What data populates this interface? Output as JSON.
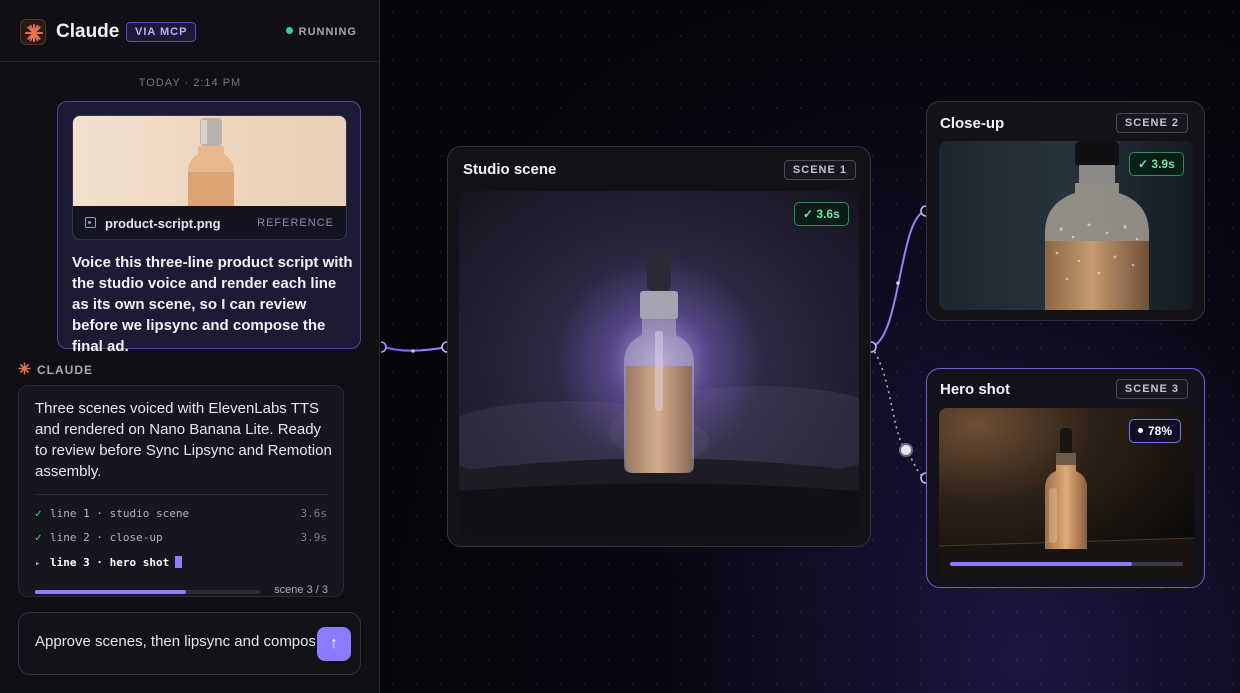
{
  "header": {
    "title": "Claude",
    "via_badge": "VIA MCP",
    "status": "RUNNING"
  },
  "chat": {
    "timestamp": "TODAY · 2:14 PM",
    "user_message": {
      "attachment_name": "product-script.png",
      "attachment_tag": "REFERENCE",
      "text": "Voice this three-line product script with the studio voice and render each line as its own scene, so I can review before we lipsync and compose the final ad."
    },
    "assistant": {
      "label": "CLAUDE",
      "text": "Three scenes voiced with ElevenLabs TTS and rendered on Nano Banana Lite. Ready to review before Sync Lipsync and Remotion assembly.",
      "lines": [
        {
          "mark": "✓",
          "text": "line 1 · studio scene",
          "time": "3.6s"
        },
        {
          "mark": "✓",
          "text": "line 2 · close-up",
          "time": "3.9s"
        },
        {
          "mark": "▸",
          "text": "line 3 · hero shot",
          "time": ""
        }
      ],
      "progress": 0.67,
      "progress_label": "scene 3 / 3"
    },
    "composer": {
      "value": "Approve scenes, then lipsync and compose",
      "send_icon": "arrow-up-icon"
    }
  },
  "canvas": {
    "nodes": {
      "studio": {
        "title": "Studio scene",
        "tag": "SCENE 1",
        "badge": "✓ 3.6s"
      },
      "closeup": {
        "title": "Close-up",
        "tag": "SCENE 2",
        "badge": "✓ 3.9s"
      },
      "hero": {
        "title": "Hero shot",
        "tag": "SCENE 3",
        "badge": "78%",
        "progress": 0.78
      }
    }
  },
  "colors": {
    "accent": "#8b7bff",
    "success": "#4ade80",
    "running": "#34d399"
  }
}
